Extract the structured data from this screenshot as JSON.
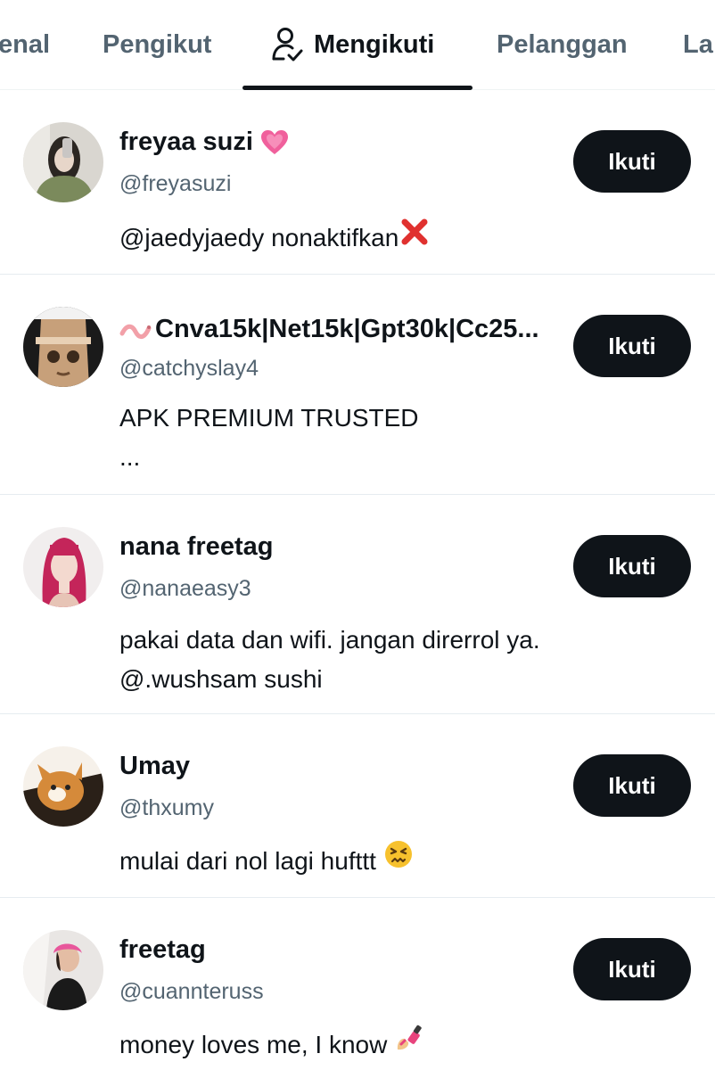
{
  "tabs": [
    {
      "label": "enal"
    },
    {
      "label": "Pengikut"
    },
    {
      "label": "Mengikuti"
    },
    {
      "label": "Pelanggan"
    },
    {
      "label": "La"
    }
  ],
  "users": [
    {
      "name": "freyaa suzi",
      "handle": "@freyasuzi",
      "bio": [
        "@jaedyjaedy nonaktifkan"
      ],
      "name_emoji": "pink-heart-icon",
      "bio_emoji": "cross-mark-icon",
      "button": "Ikuti"
    },
    {
      "name": "Cnva15k|Net15k|Gpt30k|Cc25...",
      "handle": "@catchyslay4",
      "bio": [
        "APK PREMIUM TRUSTED",
        "..."
      ],
      "name_emoji": "worm-icon",
      "button": "Ikuti"
    },
    {
      "name": "nana freetag",
      "handle": "@nanaeasy3",
      "bio": [
        "pakai data dan wifi. jangan direrrol ya.",
        "@.wushsam sushi"
      ],
      "button": "Ikuti"
    },
    {
      "name": "Umay",
      "handle": "@thxumy",
      "bio": [
        "mulai dari nol lagi hufttt"
      ],
      "bio_emoji": "persevering-face-icon",
      "button": "Ikuti"
    },
    {
      "name": "freetag",
      "handle": "@cuannteruss",
      "bio": [
        "money loves me, I know"
      ],
      "bio_emoji": "nail-polish-icon",
      "button": "Ikuti"
    }
  ],
  "colors": {
    "primary_text": "#0f1419",
    "secondary_text": "#536471",
    "button_bg": "#0f1419",
    "divider": "#e6ecf0"
  }
}
